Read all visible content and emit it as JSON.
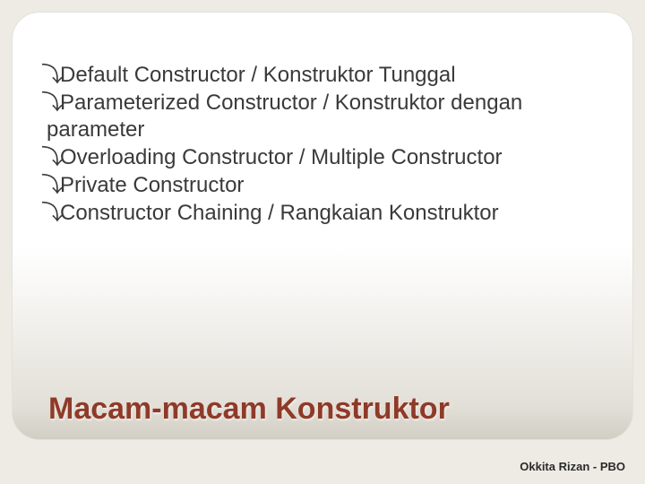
{
  "bullet_glyph": "⤵",
  "items": [
    "Default Constructor / Konstruktor Tunggal",
    "Parameterized Constructor / Konstruktor dengan parameter",
    "Overloading Constructor / Multiple Constructor",
    "Private Constructor",
    "Constructor Chaining / Rangkaian Konstruktor"
  ],
  "title": "Macam-macam Konstruktor",
  "footer": "Okkita Rizan - PBO"
}
